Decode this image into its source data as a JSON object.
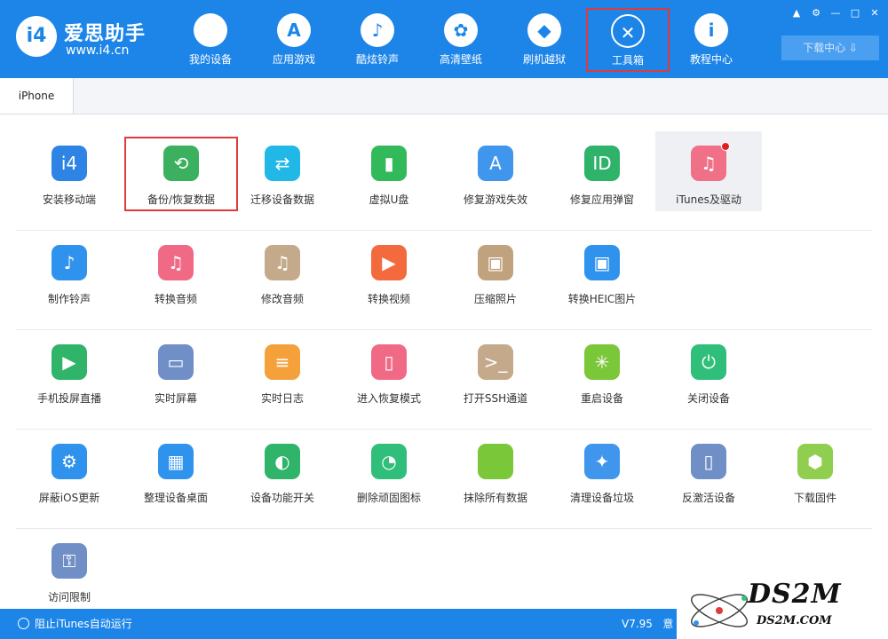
{
  "brand": {
    "logo_text": "i4",
    "name": "爱思助手",
    "url": "www.i4.cn"
  },
  "nav": [
    {
      "label": "我的设备",
      "icon": "apple-icon",
      "glyph": ""
    },
    {
      "label": "应用游戏",
      "icon": "app-store-icon",
      "glyph": "A"
    },
    {
      "label": "酷炫铃声",
      "icon": "bell-icon",
      "glyph": "♪"
    },
    {
      "label": "高清壁纸",
      "icon": "flower-icon",
      "glyph": "✿"
    },
    {
      "label": "刷机越狱",
      "icon": "dropbox-icon",
      "glyph": "◆"
    },
    {
      "label": "工具箱",
      "icon": "tools-icon",
      "glyph": "✕",
      "active": true
    },
    {
      "label": "教程中心",
      "icon": "info-icon",
      "glyph": "i"
    }
  ],
  "window": {
    "buttons": [
      "shirt",
      "gear",
      "minimize",
      "maximize",
      "close"
    ],
    "glyphs": [
      "▲",
      "⚙",
      "—",
      "□",
      "✕"
    ]
  },
  "download_center": "下载中心 ⇩",
  "tabs": {
    "iphone": "iPhone"
  },
  "tools": {
    "row1": [
      {
        "label": "安装移动端",
        "icon": "i4-icon",
        "glyph": "i4",
        "color": "#2d84e5"
      },
      {
        "label": "备份/恢复数据",
        "icon": "backup-clock-icon",
        "glyph": "⟲",
        "color": "#3bb160",
        "boxed": true
      },
      {
        "label": "迁移设备数据",
        "icon": "migrate-phones-icon",
        "glyph": "⇄",
        "color": "#21b8e8"
      },
      {
        "label": "虚拟U盘",
        "icon": "usb-drive-icon",
        "glyph": "▮",
        "color": "#31b95a"
      },
      {
        "label": "修复游戏失效",
        "icon": "repair-app-icon",
        "glyph": "A",
        "color": "#3f96ec"
      },
      {
        "label": "修复应用弹窗",
        "icon": "apple-id-icon",
        "glyph": "ID",
        "color": "#2fb36b"
      },
      {
        "label": "iTunes及驱动",
        "icon": "itunes-icon",
        "glyph": "♫",
        "color": "#f07088",
        "hover": true,
        "badge": true
      }
    ],
    "row2": [
      {
        "label": "制作铃声",
        "icon": "bell-plus-icon",
        "glyph": "♪",
        "color": "#2f93ee"
      },
      {
        "label": "转换音频",
        "icon": "music-convert-icon",
        "glyph": "♫",
        "color": "#f06a86"
      },
      {
        "label": "修改音频",
        "icon": "music-edit-icon",
        "glyph": "♫",
        "color": "#c4a98b"
      },
      {
        "label": "转换视频",
        "icon": "video-convert-icon",
        "glyph": "▶",
        "color": "#f26a3e"
      },
      {
        "label": "压缩照片",
        "icon": "photo-compress-icon",
        "glyph": "▣",
        "color": "#c0a27e"
      },
      {
        "label": "转换HEIC图片",
        "icon": "heic-convert-icon",
        "glyph": "▣",
        "color": "#2f93ee"
      }
    ],
    "row3": [
      {
        "label": "手机投屏直播",
        "icon": "screen-cast-icon",
        "glyph": "▶",
        "color": "#2fb46a"
      },
      {
        "label": "实时屏幕",
        "icon": "monitor-icon",
        "glyph": "▭",
        "color": "#6f8fc6"
      },
      {
        "label": "实时日志",
        "icon": "log-icon",
        "glyph": "≡",
        "color": "#f4a13c"
      },
      {
        "label": "进入恢复模式",
        "icon": "recovery-mode-icon",
        "glyph": "▯",
        "color": "#f06a86"
      },
      {
        "label": "打开SSH通道",
        "icon": "ssh-terminal-icon",
        "glyph": ">_",
        "color": "#c4a98b"
      },
      {
        "label": "重启设备",
        "icon": "restart-icon",
        "glyph": "✳",
        "color": "#7bc73a"
      },
      {
        "label": "关闭设备",
        "icon": "power-icon",
        "glyph": "⏻",
        "color": "#2fbf7a"
      }
    ],
    "row4": [
      {
        "label": "屏蔽iOS更新",
        "icon": "block-update-icon",
        "glyph": "⚙",
        "color": "#2f93ee"
      },
      {
        "label": "整理设备桌面",
        "icon": "desktop-grid-icon",
        "glyph": "▦",
        "color": "#2f93ee"
      },
      {
        "label": "设备功能开关",
        "icon": "toggle-switch-icon",
        "glyph": "◐",
        "color": "#2fb46a"
      },
      {
        "label": "删除顽固图标",
        "icon": "delete-icon-pie-icon",
        "glyph": "◔",
        "color": "#2fbf7a"
      },
      {
        "label": "抹除所有数据",
        "icon": "erase-apple-icon",
        "glyph": "",
        "color": "#7bc73a"
      },
      {
        "label": "清理设备垃圾",
        "icon": "broom-icon",
        "glyph": "✦",
        "color": "#3f96ec"
      },
      {
        "label": "反激活设备",
        "icon": "deactivate-icon",
        "glyph": "▯",
        "color": "#6f8fc6"
      },
      {
        "label": "下载固件",
        "icon": "firmware-box-icon",
        "glyph": "⬢",
        "color": "#8fce4e"
      }
    ],
    "row5": [
      {
        "label": "访问限制",
        "icon": "key-icon",
        "glyph": "⚿",
        "color": "#6f8fc6"
      }
    ]
  },
  "status": {
    "block_itunes": "阻止iTunes自动运行",
    "version": "V7.95",
    "extra": "意"
  },
  "watermark": {
    "big": "DS2M",
    "small": "DS2M.COM"
  }
}
